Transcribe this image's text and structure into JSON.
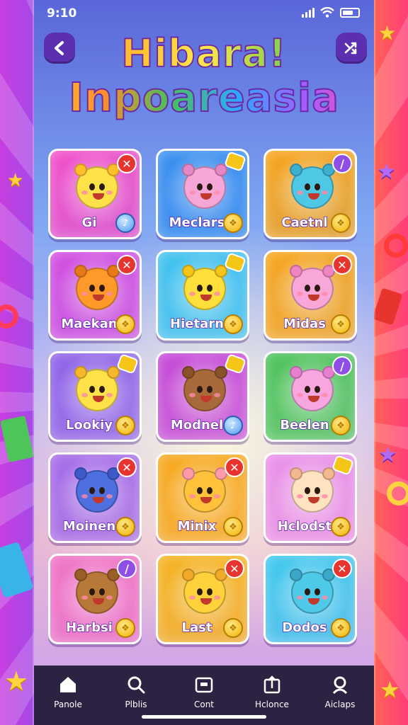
{
  "status": {
    "time": "9:10"
  },
  "header": {
    "title_line1": "Hibara!",
    "title_line2": "Inpoareasia",
    "back_icon": "chevron-left-icon",
    "shuffle_icon": "shuffle-icon"
  },
  "cards": [
    {
      "name": "Gi",
      "bg": "#f24fc9",
      "body": "#ffe14a",
      "ear": "#ffbf2a",
      "badge": "remove",
      "coin": "blue"
    },
    {
      "name": "Meclars",
      "bg": "#3a8ff0",
      "body": "#f7a6d8",
      "ear": "#e887c5",
      "badge": "tag",
      "coin": "gold"
    },
    {
      "name": "Caetnl",
      "bg": "#f7a51c",
      "body": "#4fc8e6",
      "ear": "#3db0cf",
      "badge": "edit",
      "coin": "gold"
    },
    {
      "name": "Maekan",
      "bg": "#d24de0",
      "body": "#ff9a2a",
      "ear": "#e77a18",
      "badge": "remove",
      "coin": "gold"
    },
    {
      "name": "Hietarn",
      "bg": "#3fc2ef",
      "body": "#ffe03a",
      "ear": "#f5c51a",
      "badge": "tag",
      "coin": "gold"
    },
    {
      "name": "Midas",
      "bg": "#f7a51c",
      "body": "#f9a6d9",
      "ear": "#ef85c3",
      "badge": "remove",
      "coin": "gold"
    },
    {
      "name": "Lookiy",
      "bg": "#8f63e8",
      "body": "#ffe14a",
      "ear": "#f5b82a",
      "badge": "tag",
      "coin": "gold"
    },
    {
      "name": "Modnel",
      "bg": "#c548d7",
      "body": "#a86a3a",
      "ear": "#8a5228",
      "badge": "tag",
      "coin": "blue"
    },
    {
      "name": "Beelen",
      "bg": "#4cc25a",
      "body": "#f7a6e0",
      "ear": "#e67fcf",
      "badge": "edit",
      "coin": "gold"
    },
    {
      "name": "Moinen",
      "bg": "#a46ae8",
      "body": "#4d6fe0",
      "ear": "#3d5ac8",
      "badge": "remove",
      "coin": "gold"
    },
    {
      "name": "Minix",
      "bg": "#f7a81c",
      "body": "#ffc23a",
      "ear": "#ff9aa8",
      "badge": "remove",
      "coin": "gold"
    },
    {
      "name": "Hclodst",
      "bg": "#e98fe8",
      "body": "#ffe2c0",
      "ear": "#f2b890",
      "badge": "tag",
      "coin": "gold"
    },
    {
      "name": "Harbsi",
      "bg": "#ef72c6",
      "body": "#b87838",
      "ear": "#9a5f26",
      "badge": "edit",
      "coin": "gold"
    },
    {
      "name": "Last",
      "bg": "#f5b21e",
      "body": "#ffd13a",
      "ear": "#f0a928",
      "badge": "remove",
      "coin": "gold"
    },
    {
      "name": "Dodos",
      "bg": "#3ec7ee",
      "body": "#4fc9e8",
      "ear": "#3aa8c8",
      "badge": "remove",
      "coin": "gold"
    }
  ],
  "nav": [
    {
      "label": "Panole",
      "icon": "home-icon"
    },
    {
      "label": "Plblis",
      "icon": "search-icon"
    },
    {
      "label": "Cont",
      "icon": "folder-icon"
    },
    {
      "label": "Hclonce",
      "icon": "upload-icon"
    },
    {
      "label": "Aiclaps",
      "icon": "profile-search-icon"
    }
  ]
}
